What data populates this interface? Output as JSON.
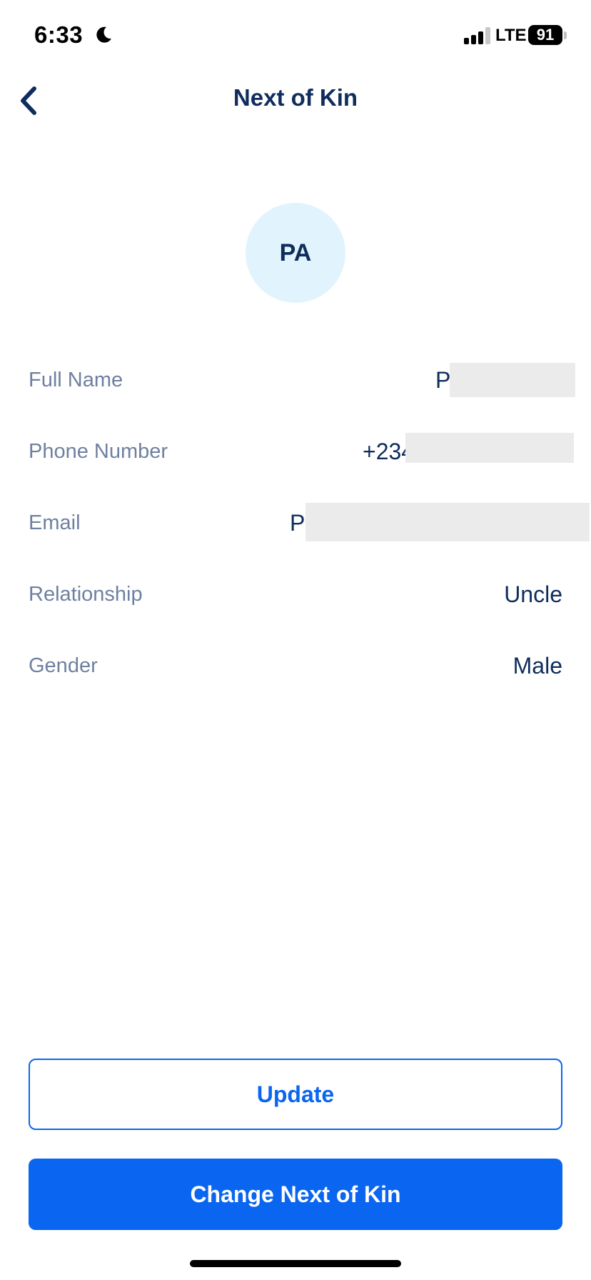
{
  "status_bar": {
    "time": "6:33",
    "network": "LTE",
    "battery": "91"
  },
  "header": {
    "title": "Next of Kin",
    "back_icon": "chevron-left-icon"
  },
  "avatar": {
    "initials": "PA",
    "background": "#e1f3fc"
  },
  "details": {
    "full_name": {
      "label": "Full Name",
      "value_visible": "P"
    },
    "phone": {
      "label": "Phone Number",
      "value_visible": "+234"
    },
    "email": {
      "label": "Email",
      "value_visible": "P"
    },
    "relationship": {
      "label": "Relationship",
      "value": "Uncle"
    },
    "gender": {
      "label": "Gender",
      "value": "Male"
    }
  },
  "actions": {
    "update_label": "Update",
    "change_label": "Change Next of Kin"
  },
  "colors": {
    "primary": "#0a66f0",
    "text_dark": "#0f2d5c",
    "text_muted": "#6f80a0",
    "redaction": "#ebebeb"
  }
}
